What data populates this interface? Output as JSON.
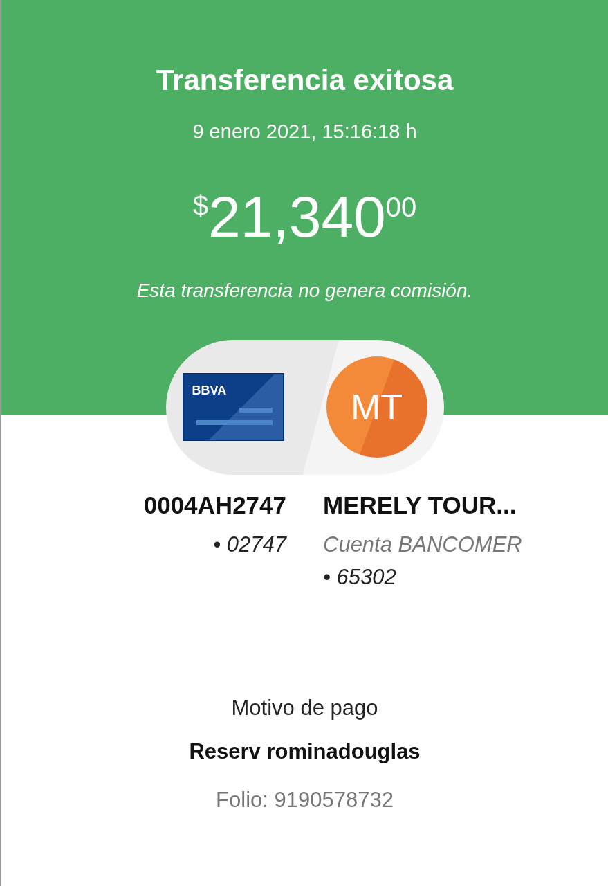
{
  "header": {
    "title": "Transferencia exitosa",
    "date": "9 enero 2021, 15:16:18 h",
    "amount": {
      "currency": "$",
      "integer": "21,340",
      "cents": "00"
    },
    "note": "Esta transferencia no genera comisión."
  },
  "origin": {
    "card_brand": "BBVA",
    "name": "0004AH2747",
    "number": "• 02747"
  },
  "destination": {
    "initials": "MT",
    "name": "MERELY TOUR...",
    "bank": "Cuenta BANCOMER",
    "number": "• 65302"
  },
  "details": {
    "label": "Motivo de pago",
    "value": "Reserv rominadouglas",
    "folio": "Folio: 9190578732"
  }
}
